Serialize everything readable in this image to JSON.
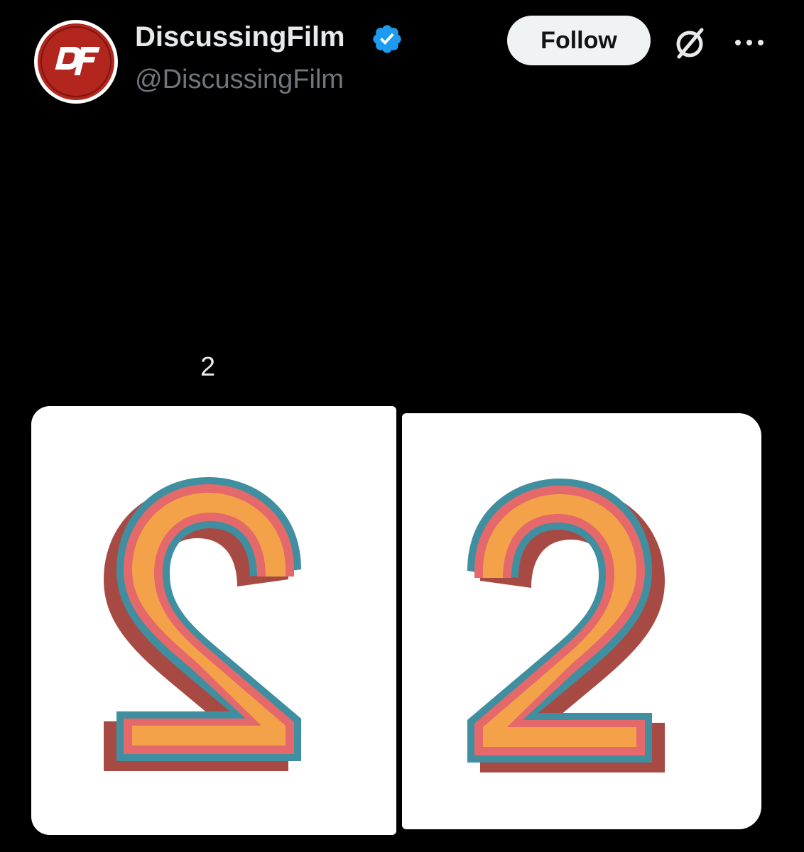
{
  "account": {
    "display_name": "DiscussingFilm",
    "handle": "@DiscussingFilm",
    "verified": true,
    "avatar_logo_text": "DF",
    "avatar_color": "#b3261e"
  },
  "actions": {
    "follow_label": "Follow",
    "grok_icon": "grok-slash-icon",
    "more_icon": "more-dots-icon"
  },
  "post": {
    "text": "2"
  },
  "media": [
    {
      "description_icon": "mirrored-number-two",
      "mirrored": true
    },
    {
      "description_icon": "number-two",
      "mirrored": false
    }
  ],
  "colors": {
    "background": "#000000",
    "verified_badge": "#1d9bf0",
    "follow_button_bg": "#eff3f4"
  }
}
